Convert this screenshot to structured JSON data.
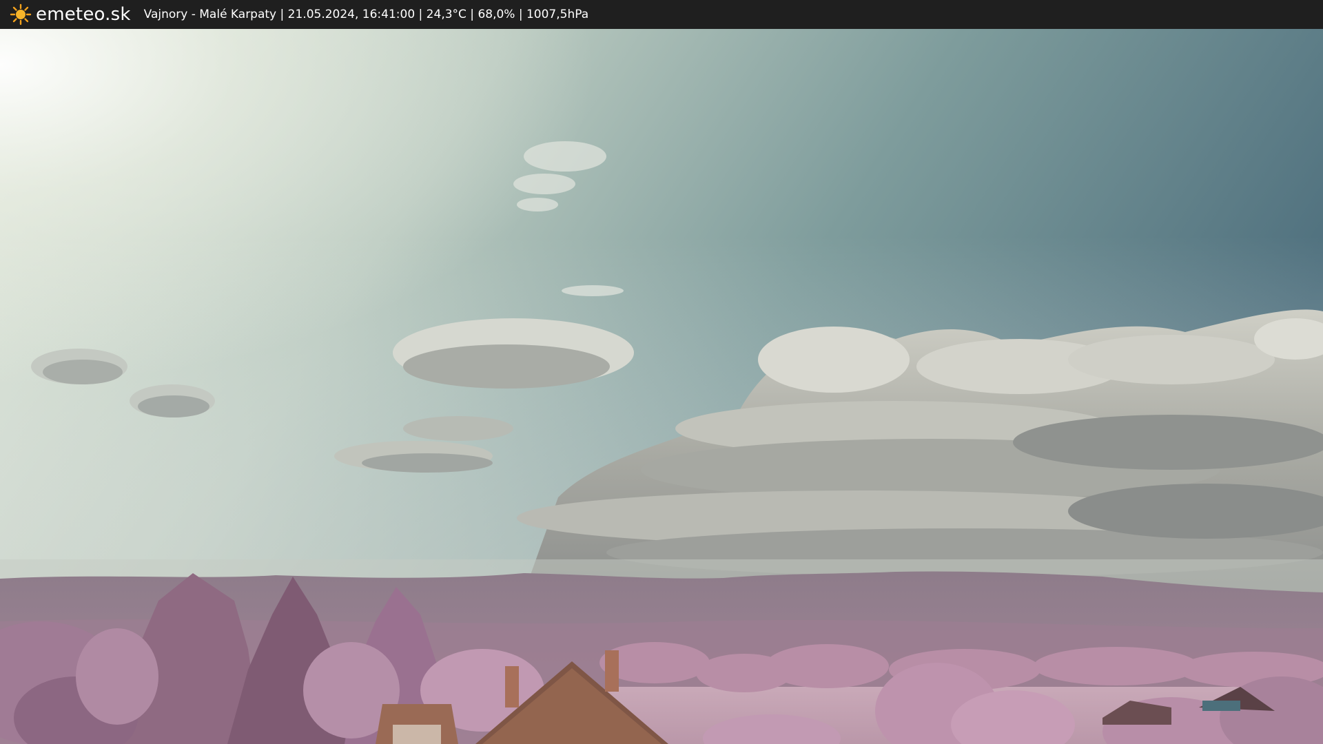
{
  "header": {
    "brand": "emeteo.sk",
    "logo_icon": "sun-icon",
    "caption": "Vajnory - Malé Karpaty | 21.05.2024, 16:41:00 | 24,3°C | 68,0% | 1007,5hPa"
  },
  "colors": {
    "bar_background": "#1f1f1f",
    "sun_orange": "#f4a21c",
    "sky_top_right": "#547784",
    "sky_bottom_left": "#d9e3d6",
    "foliage_pink": "#b98aa2",
    "roof_brown": "#8a5a45"
  }
}
